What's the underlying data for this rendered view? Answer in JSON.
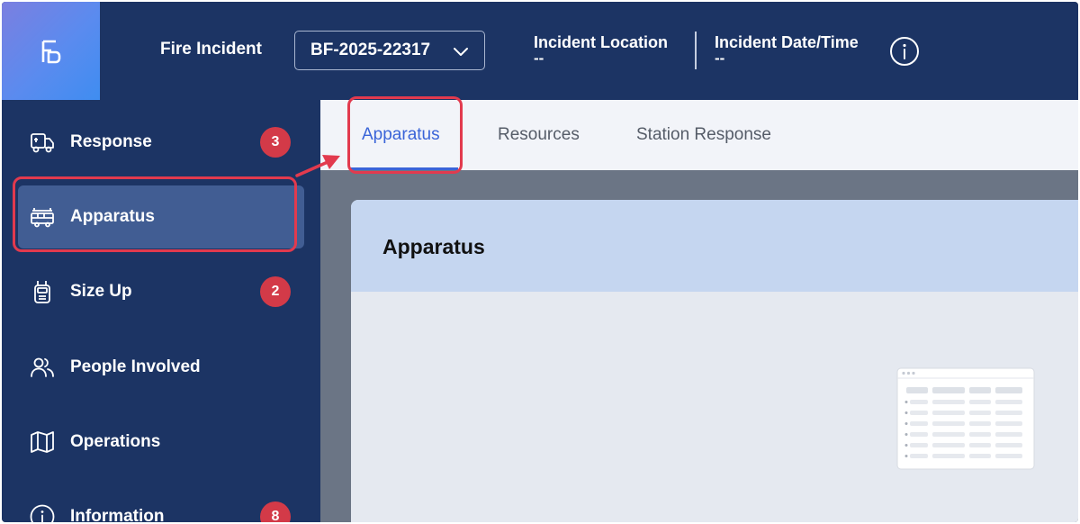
{
  "header": {
    "title": "Fire Incident",
    "incident_id": "BF-2025-22317",
    "location_label": "Incident Location",
    "location_value": "--",
    "datetime_label": "Incident Date/Time",
    "datetime_value": "--"
  },
  "sidebar": {
    "items": [
      {
        "label": "Response",
        "icon": "truck-icon",
        "badge": "3"
      },
      {
        "label": "Apparatus",
        "icon": "fire-engine-icon",
        "badge": ""
      },
      {
        "label": "Size Up",
        "icon": "radio-icon",
        "badge": "2"
      },
      {
        "label": "People Involved",
        "icon": "people-icon",
        "badge": ""
      },
      {
        "label": "Operations",
        "icon": "map-icon",
        "badge": ""
      },
      {
        "label": "Information",
        "icon": "info-icon",
        "badge": "8"
      }
    ]
  },
  "tabs": [
    {
      "label": "Apparatus",
      "active": true
    },
    {
      "label": "Resources",
      "active": false
    },
    {
      "label": "Station Response",
      "active": false
    }
  ],
  "main": {
    "section_title": "Apparatus"
  },
  "colors": {
    "navy": "#1c3464",
    "active_item": "#415d93",
    "accent_blue": "#3a64d8",
    "badge_red": "#d33a48",
    "annotation_red": "#e23a4e"
  }
}
